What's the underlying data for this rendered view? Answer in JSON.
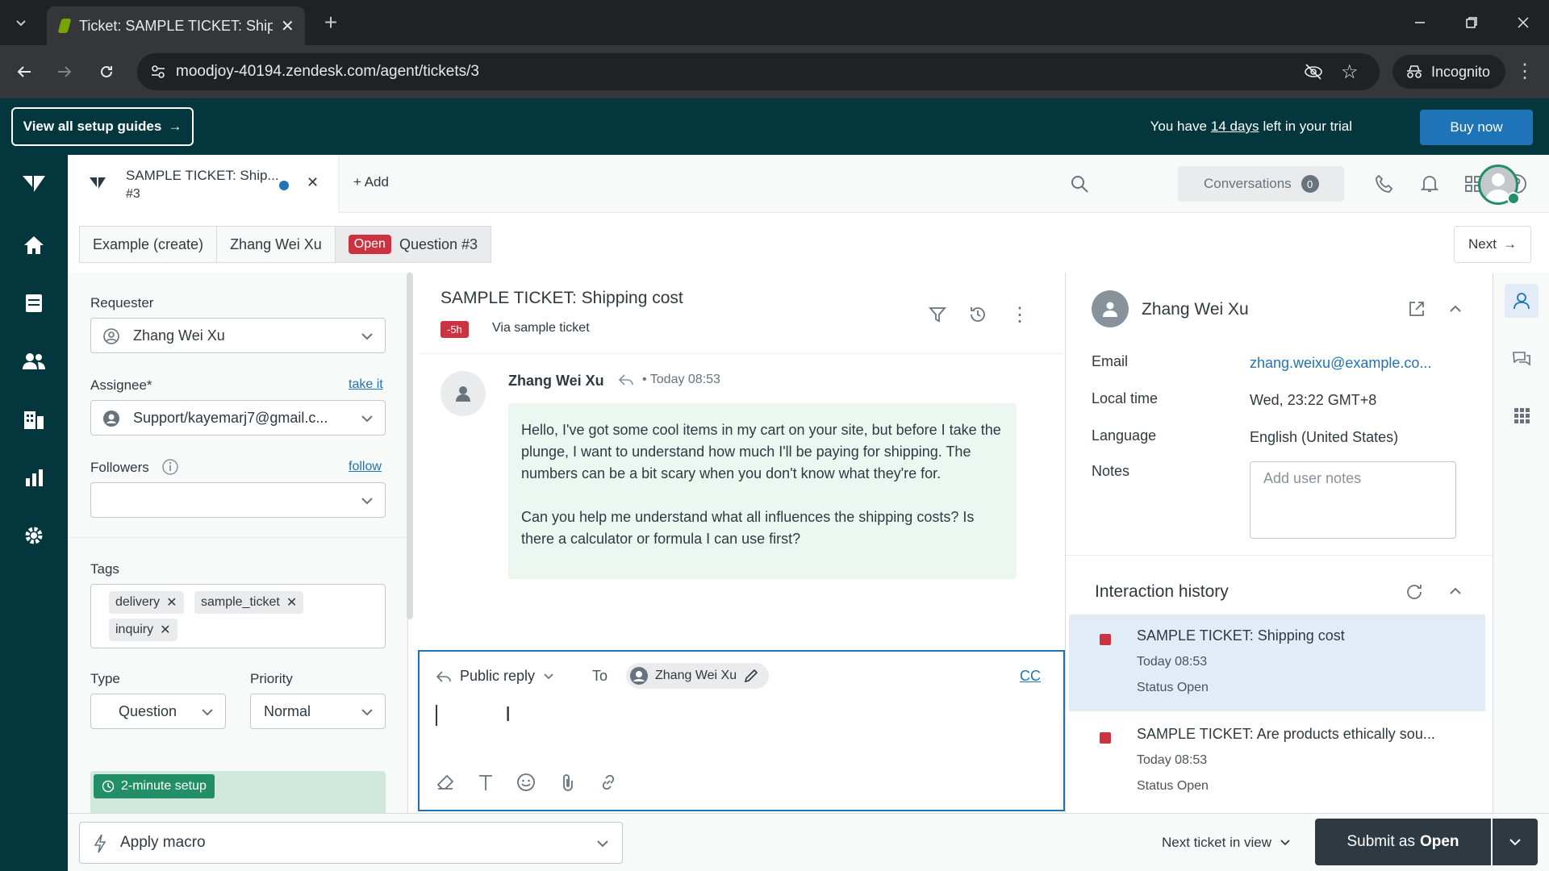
{
  "browser": {
    "tab_title": "Ticket: SAMPLE TICKET: Shippin",
    "url": "moodjoy-40194.zendesk.com/agent/tickets/3",
    "incognito_label": "Incognito"
  },
  "trial_bar": {
    "guides_label": "View all setup guides",
    "trial_prefix": "You have",
    "trial_days": "14 days",
    "trial_suffix": "left in your trial",
    "buy_label": "Buy now"
  },
  "header": {
    "ticket_tab_title": "SAMPLE TICKET: Ship...",
    "ticket_tab_number": "#3",
    "add_label": "Add",
    "conversations_label": "Conversations",
    "conversations_count": "0"
  },
  "breadcrumbs": {
    "items": [
      "Example (create)",
      "Zhang Wei Xu"
    ],
    "status": "Open",
    "current": "Question #3",
    "next_label": "Next"
  },
  "properties": {
    "requester_label": "Requester",
    "requester_value": "Zhang Wei Xu",
    "assignee_label": "Assignee*",
    "take_it": "take it",
    "assignee_value": "Support/kayemarj7@gmail.c...",
    "followers_label": "Followers",
    "follow": "follow",
    "tags_label": "Tags",
    "tags": [
      "delivery",
      "sample_ticket",
      "inquiry"
    ],
    "type_label": "Type",
    "type_value": "Question",
    "priority_label": "Priority",
    "priority_value": "Normal",
    "setup_label": "2-minute setup"
  },
  "conversation": {
    "title": "SAMPLE TICKET: Shipping cost",
    "sla": "-5h",
    "via": "Via sample ticket",
    "author": "Zhang Wei Xu",
    "time": "Today 08:53",
    "paragraph1": "Hello, I've got some cool items in my cart on your site, but before I take the plunge, I want to understand how much I'll be paying for shipping. The numbers can be a bit scary when you don't know what they're for.",
    "paragraph2": "Can you help me understand what all influences the shipping costs? Is there a calculator or formula I can use first?"
  },
  "composer": {
    "reply_type": "Public reply",
    "to_label": "To",
    "recipient": "Zhang Wei Xu",
    "cc_label": "CC"
  },
  "user_panel": {
    "name": "Zhang Wei Xu",
    "email_label": "Email",
    "email_value": "zhang.weixu@example.co...",
    "localtime_label": "Local time",
    "localtime_value": "Wed, 23:22 GMT+8",
    "language_label": "Language",
    "language_value": "English (United States)",
    "notes_label": "Notes",
    "notes_placeholder": "Add user notes",
    "history_title": "Interaction history",
    "history": [
      {
        "title": "SAMPLE TICKET: Shipping cost",
        "time": "Today 08:53",
        "status_label": "Status",
        "status": "Open"
      },
      {
        "title": "SAMPLE TICKET: Are products ethically sou...",
        "time": "Today 08:53",
        "status_label": "Status",
        "status": "Open"
      }
    ]
  },
  "footer": {
    "macro_label": "Apply macro",
    "next_ticket_label": "Next ticket in view",
    "submit_prefix": "Submit as",
    "submit_status": "Open"
  },
  "colors": {
    "brand_dark": "#03363d",
    "accent_blue": "#1f73b7",
    "open_red": "#cc3340",
    "message_bg": "#edf7f1"
  }
}
